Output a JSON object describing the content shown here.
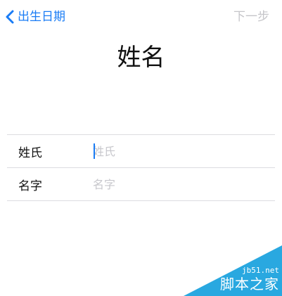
{
  "nav": {
    "back_label": "出生日期",
    "next_label": "下一步"
  },
  "title": "姓名",
  "form": {
    "rows": [
      {
        "label": "姓氏",
        "value": "",
        "placeholder": "姓氏",
        "focused": true
      },
      {
        "label": "名字",
        "value": "",
        "placeholder": "名字",
        "focused": false
      }
    ]
  },
  "watermark": {
    "url": "jb51.net",
    "name": "脚本之家"
  },
  "colors": {
    "accent": "#1a7cf5",
    "disabled": "#c5c5c9",
    "placeholder": "#c7c7cc",
    "divider": "#dcdce0",
    "watermark": "#29a8e0"
  },
  "icons": {
    "back": "chevron-left-icon"
  }
}
